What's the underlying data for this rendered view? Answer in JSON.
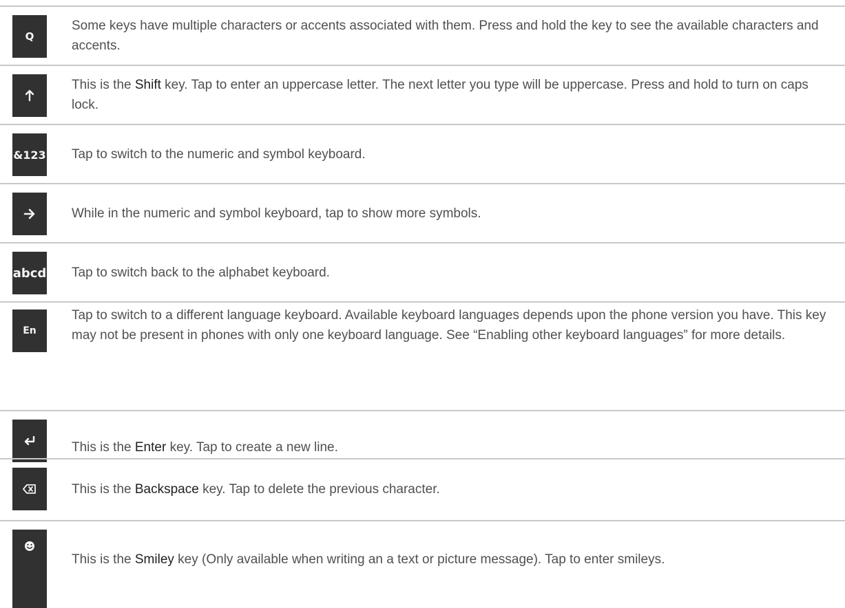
{
  "rows": [
    {
      "key_label": "Q",
      "key_icon": "q-key-icon",
      "text_parts": [
        "Some keys have multiple characters or accents associated with them. Press and hold the key to see the available characters and accents."
      ]
    },
    {
      "key_label": "",
      "key_icon": "shift-arrow-up-icon",
      "text_parts": [
        "This is the ",
        "Shift",
        " key. Tap to enter an uppercase letter. The next letter you type will be uppercase. Press and hold to turn on caps lock."
      ]
    },
    {
      "key_label": "&123",
      "key_icon": "numeric-symbol-key-icon",
      "text_parts": [
        "Tap to switch to the numeric and symbol keyboard."
      ]
    },
    {
      "key_label": "",
      "key_icon": "arrow-right-icon",
      "text_parts": [
        "While in the numeric and symbol keyboard, tap to show more symbols."
      ]
    },
    {
      "key_label": "abcd",
      "key_icon": "alphabet-key-icon",
      "text_parts": [
        "Tap to switch back to the alphabet keyboard."
      ]
    },
    {
      "key_label": "En",
      "key_icon": "language-key-icon",
      "text_parts": [
        "Tap to switch to a different language keyboard. Available keyboard languages depends upon the phone version you have. This key may not be present in phones with only one keyboard language. See “Enabling other keyboard languages” for more details."
      ]
    },
    {
      "key_label": "",
      "key_icon": "enter-return-icon",
      "text_parts": [
        "This is the ",
        "Enter",
        " key. Tap to create a new line."
      ]
    },
    {
      "key_label": "",
      "key_icon": "backspace-icon",
      "text_parts": [
        "This is the ",
        "Backspace",
        " key. Tap to delete the previous character."
      ]
    },
    {
      "key_label": "",
      "key_icon": "smiley-icon",
      "text_parts": [
        "This is the ",
        "Smiley",
        " key (Only available when writing an a text or picture message). Tap to enter smileys."
      ]
    }
  ]
}
